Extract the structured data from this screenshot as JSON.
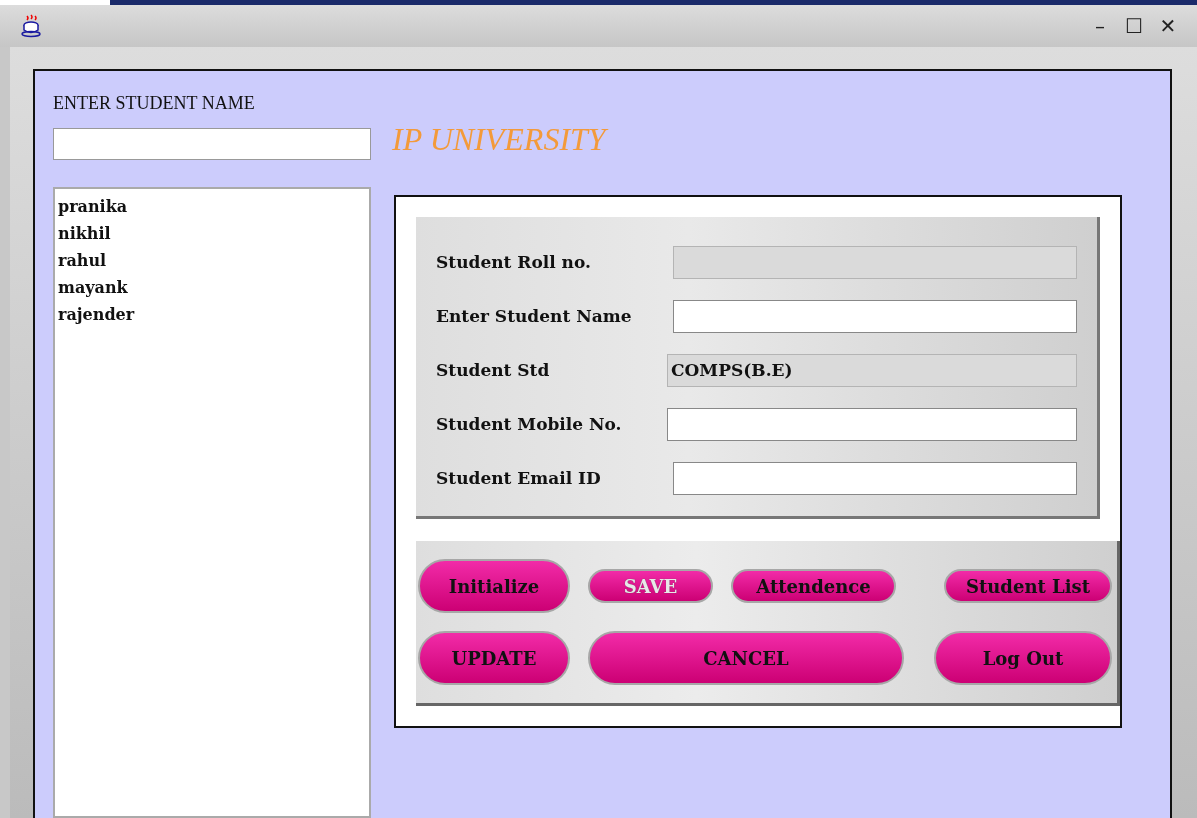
{
  "window": {
    "controls": [
      "–",
      "☐",
      "✕"
    ]
  },
  "search": {
    "label": "ENTER STUDENT NAME"
  },
  "title": "IP UNIVERSITY",
  "students": [
    {
      "name": "pranika"
    },
    {
      "name": "nikhil"
    },
    {
      "name": "rahul"
    },
    {
      "name": "mayank"
    },
    {
      "name": "rajender"
    }
  ],
  "form": [
    {
      "label": "Student Roll no.",
      "disabled": true
    },
    {
      "label": "Enter Student Name",
      "disabled": false
    },
    {
      "label": "Student Std",
      "value": "COMPS(B.E)",
      "disabled": true
    },
    {
      "label": "Student Mobile No.",
      "disabled": false
    },
    {
      "label": "Student Email ID",
      "disabled": false
    }
  ],
  "buttons": [
    {
      "label": "Initialize",
      "kind": "large",
      "disabled": false
    },
    {
      "label": "SAVE",
      "kind": "small",
      "disabled": true
    },
    {
      "label": "Attendence",
      "kind": "small",
      "disabled": false
    },
    {
      "label": "Student List",
      "kind": "small",
      "disabled": false
    },
    {
      "label": "UPDATE",
      "kind": "large",
      "disabled": false
    },
    {
      "label": "CANCEL",
      "kind": "large",
      "disabled": false
    },
    {
      "label": "Log Out",
      "kind": "large",
      "disabled": false
    }
  ]
}
